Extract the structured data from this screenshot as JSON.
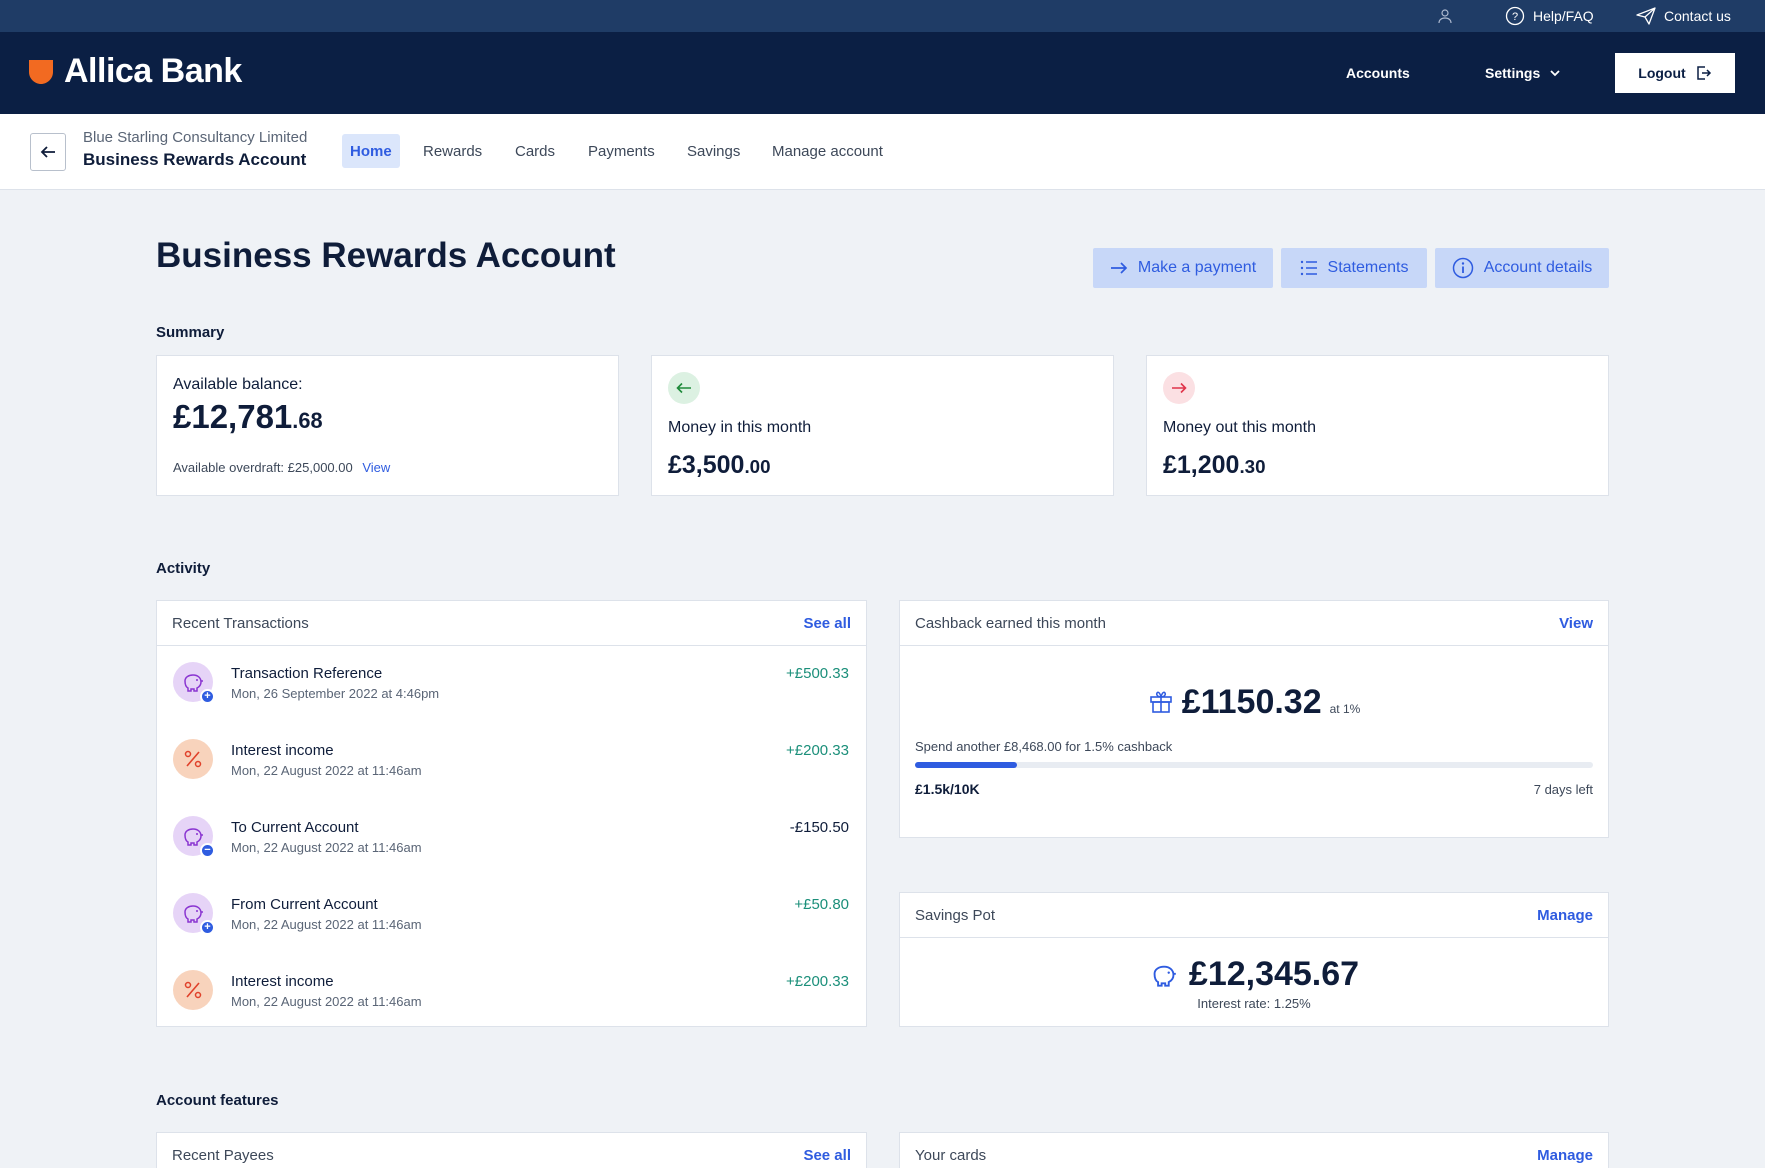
{
  "topbar": {
    "help": "Help/FAQ",
    "contact": "Contact us"
  },
  "header": {
    "brand": "Allica Bank",
    "accounts": "Accounts",
    "settings": "Settings",
    "logout": "Logout"
  },
  "subnav": {
    "company": "Blue Starling Consultancy Limited",
    "account": "Business Rewards Account",
    "tabs": [
      "Home",
      "Rewards",
      "Cards",
      "Payments",
      "Savings",
      "Manage account"
    ],
    "active_tab": "Home"
  },
  "page": {
    "title": "Business Rewards Account",
    "actions": {
      "payment": "Make a payment",
      "statements": "Statements",
      "details": "Account details"
    }
  },
  "summary": {
    "label": "Summary",
    "balance": {
      "label": "Available balance:",
      "pounds": "£12,781",
      "pence": ".68",
      "overdraft": "Available overdraft: £25,000.00",
      "overdraft_link": "View"
    },
    "money_in": {
      "label": "Money in this month",
      "pounds": "£3,500",
      "pence": ".00"
    },
    "money_out": {
      "label": "Money out this month",
      "pounds": "£1,200",
      "pence": ".30"
    }
  },
  "activity": {
    "label": "Activity",
    "recent": {
      "title": "Recent Transactions",
      "link": "See all",
      "items": [
        {
          "name": "Transaction Reference",
          "date": "Mon, 26 September 2022 at 4:46pm",
          "amount": "+£500.33",
          "icon": "piggy-bank-icon",
          "badge": "+"
        },
        {
          "name": "Interest income",
          "date": "Mon, 22 August 2022 at 11:46am",
          "amount": "+£200.33",
          "icon": "percent-icon",
          "badge": ""
        },
        {
          "name": "To Current Account",
          "date": "Mon, 22 August 2022 at 11:46am",
          "amount": "-£150.50",
          "icon": "piggy-bank-icon",
          "badge": "−"
        },
        {
          "name": "From Current Account",
          "date": "Mon, 22 August 2022 at 11:46am",
          "amount": "+£50.80",
          "icon": "piggy-bank-icon",
          "badge": "+"
        },
        {
          "name": "Interest income",
          "date": "Mon, 22 August 2022 at 11:46am",
          "amount": "+£200.33",
          "icon": "percent-icon",
          "badge": ""
        }
      ]
    },
    "cashback": {
      "title": "Cashback earned this month",
      "link": "View",
      "amount": "£1150.32",
      "rate": "at 1%",
      "spend_note": "Spend another £8,468.00 for 1.5% cashback",
      "progress_label": "£1.5k/10K",
      "progress_fraction": 0.15,
      "days_left": "7 days left"
    },
    "savings": {
      "title": "Savings Pot",
      "link": "Manage",
      "amount": "£12,345.67",
      "rate": "Interest rate: 1.25%"
    }
  },
  "features": {
    "label": "Account features",
    "payees": {
      "title": "Recent Payees",
      "link": "See all"
    },
    "cards": {
      "title": "Your cards",
      "link": "Manage"
    }
  },
  "colors": {
    "navy": "#0b1f44",
    "topbar": "#1f3c66",
    "accent": "#2f5ce0",
    "brand_orange": "#f26a21",
    "positive": "#1b8f7a",
    "money_out": "#e0334a"
  }
}
